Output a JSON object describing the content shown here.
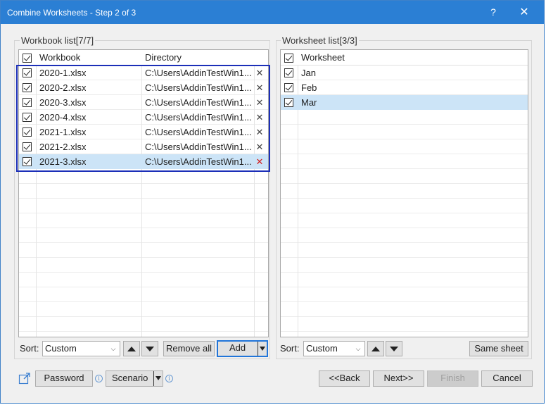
{
  "window": {
    "title": "Combine Worksheets - Step 2 of 3",
    "help": "?",
    "close": "✕"
  },
  "workbook_panel": {
    "label": "Workbook list[7/7]",
    "columns": {
      "workbook": "Workbook",
      "directory": "Directory"
    },
    "rows": [
      {
        "name": "2020-1.xlsx",
        "dir": "C:\\Users\\AddinTestWin1...",
        "selected": false
      },
      {
        "name": "2020-2.xlsx",
        "dir": "C:\\Users\\AddinTestWin1...",
        "selected": false
      },
      {
        "name": "2020-3.xlsx",
        "dir": "C:\\Users\\AddinTestWin1...",
        "selected": false
      },
      {
        "name": "2020-4.xlsx",
        "dir": "C:\\Users\\AddinTestWin1...",
        "selected": false
      },
      {
        "name": "2021-1.xlsx",
        "dir": "C:\\Users\\AddinTestWin1...",
        "selected": false
      },
      {
        "name": "2021-2.xlsx",
        "dir": "C:\\Users\\AddinTestWin1...",
        "selected": false
      },
      {
        "name": "2021-3.xlsx",
        "dir": "C:\\Users\\AddinTestWin1...",
        "selected": true
      }
    ],
    "sort_label": "Sort:",
    "sort_value": "Custom",
    "remove_all": "Remove all",
    "add": "Add"
  },
  "worksheet_panel": {
    "label": "Worksheet list[3/3]",
    "column": "Worksheet",
    "rows": [
      {
        "name": "Jan",
        "selected": false
      },
      {
        "name": "Feb",
        "selected": false
      },
      {
        "name": "Mar",
        "selected": true
      }
    ],
    "sort_label": "Sort:",
    "sort_value": "Custom",
    "same_sheet": "Same sheet"
  },
  "footer": {
    "password": "Password",
    "scenario": "Scenario",
    "back": "<<Back",
    "next": "Next>>",
    "finish": "Finish",
    "cancel": "Cancel"
  },
  "colors": {
    "titlebar": "#2b7fd4",
    "selection": "#cce4f7",
    "highlight_box": "#1c2fb8",
    "delete_active": "#d21e1e"
  }
}
